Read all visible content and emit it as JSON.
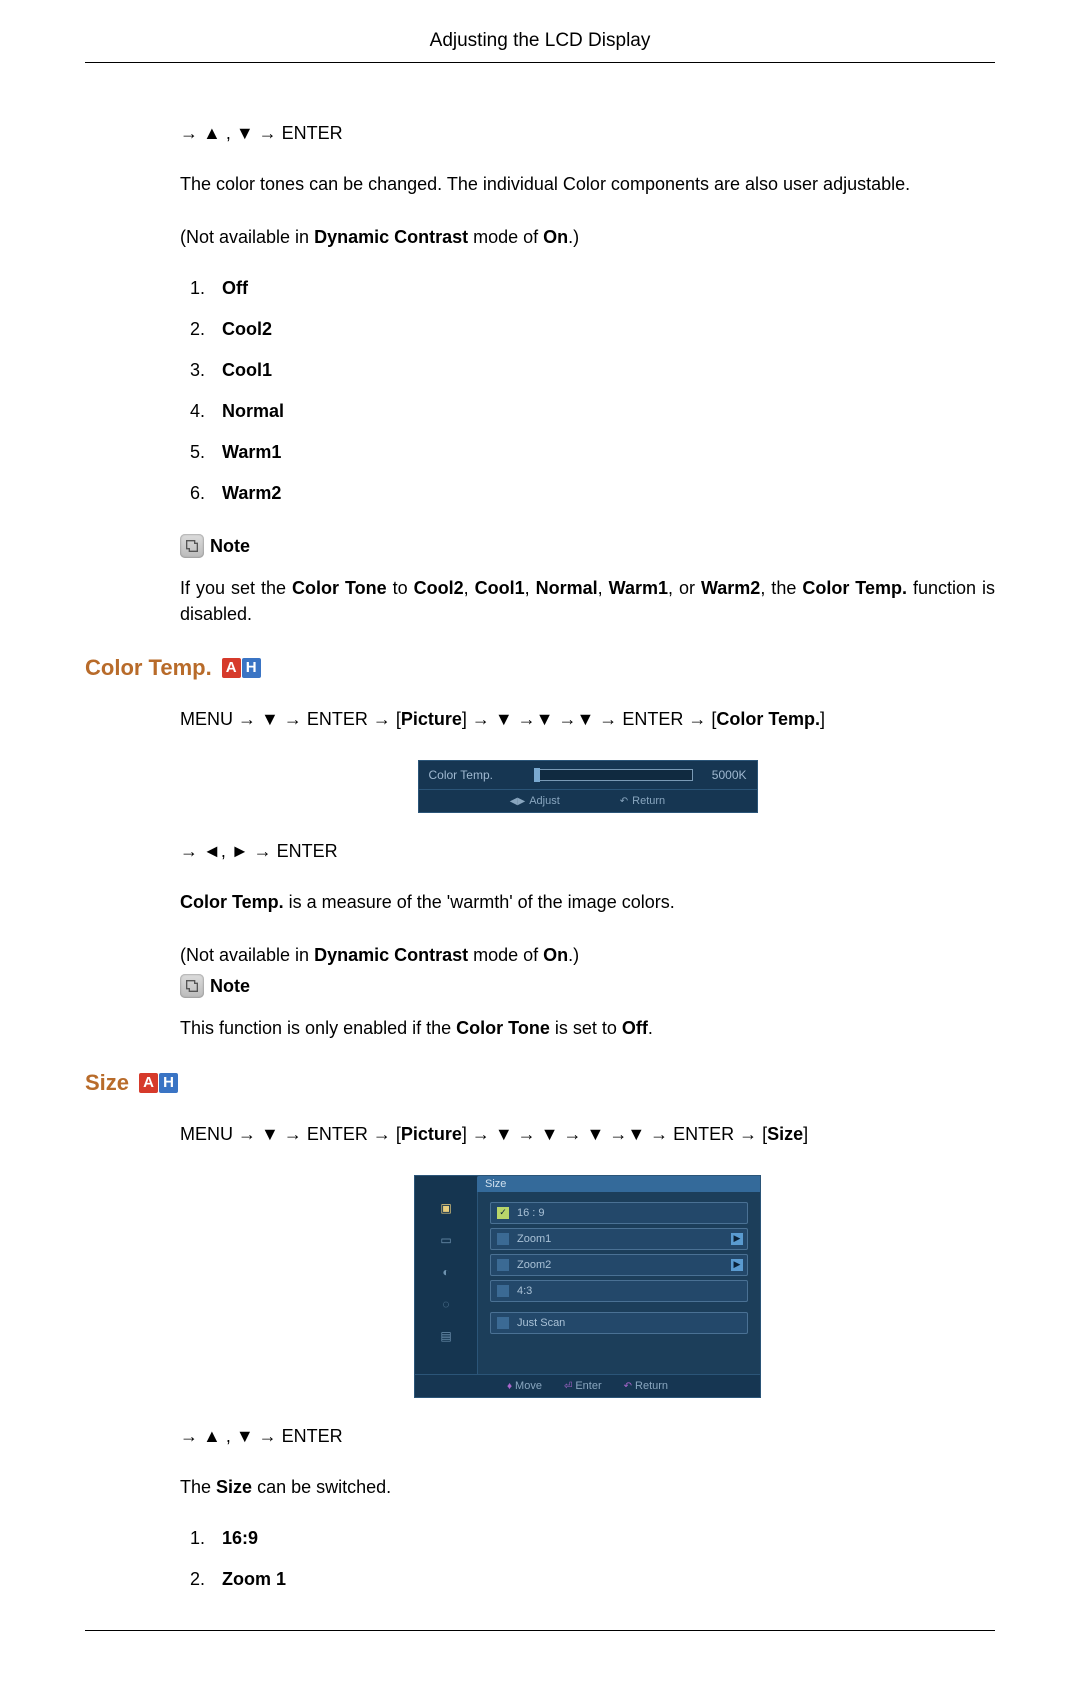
{
  "header": {
    "title": "Adjusting the LCD Display"
  },
  "nav": {
    "colorTone": "→ ▲ , ▼ → ENTER",
    "colorTempPath": "MENU → ▼ → ENTER → [",
    "colorTempPath2": "] → ▼ →▼ →▼ → ENTER → [",
    "colorTempPath3": "]",
    "colorTempAdjust": "→ ◄, ► → ENTER",
    "sizePath1": "MENU → ▼ → ENTER → [",
    "sizePath2": "] → ▼ → ▼ → ▼ →▼ → ENTER → [",
    "sizePath3": "]",
    "sizeNav": "→ ▲ , ▼ → ENTER"
  },
  "text": {
    "colorTonesDesc": "The color tones can be changed. The individual Color components are also user adjustable.",
    "notAvail1": "(Not available in ",
    "notAvail2": " mode of ",
    "notAvail3": ".)",
    "dynContrast": "Dynamic Contrast",
    "on": "On",
    "noteLabel": "Note",
    "noteColorTone1": "If you set the ",
    "noteColorTone_CT": "Color Tone",
    "noteColorTone_to": " to ",
    "noteColorTone_Cool2": "Cool2",
    "noteColorTone_Cool1": "Cool1",
    "noteColorTone_Normal": "Normal",
    "noteColorTone_Warm1": "Warm1",
    "noteColorTone_or": ", or ",
    "noteColorTone_Warm2": "Warm2",
    "noteColorTone_the": ", the ",
    "noteColorTone_ColorTemp": "Color Temp.",
    "noteColorTone_end": " function is disabled.",
    "sep": ", ",
    "colorTempTitle": "Color Temp.",
    "pictureLabel": "Picture",
    "colorTempBracket": "Color Temp.",
    "colorTempDesc1": "Color Temp.",
    "colorTempDesc2": " is a measure of the 'warmth' of the image colors.",
    "colorTempNote1": "This function is only enabled if the ",
    "colorTempNote2": "Color Tone",
    "colorTempNote3": " is set to ",
    "colorTempNote4": "Off",
    "colorTempNote5": ".",
    "sizeTitle": "Size",
    "sizeBracket": "Size",
    "sizeDesc1": "The ",
    "sizeDesc2": "Size",
    "sizeDesc3": " can be switched."
  },
  "colorToneList": [
    "Off",
    "Cool2",
    "Cool1",
    "Normal",
    "Warm1",
    "Warm2"
  ],
  "sizeList": [
    "16:9",
    "Zoom 1"
  ],
  "osd": {
    "colorTemp": {
      "label": "Color Temp.",
      "value": "5000K",
      "adjust": "Adjust",
      "return": "Return"
    },
    "size": {
      "title": "Size",
      "items": [
        "16 : 9",
        "Zoom1",
        "Zoom2",
        "4:3",
        "Just Scan"
      ],
      "move": "Move",
      "enter": "Enter",
      "return": "Return"
    }
  },
  "badges": {
    "a": "A",
    "h": "H"
  }
}
